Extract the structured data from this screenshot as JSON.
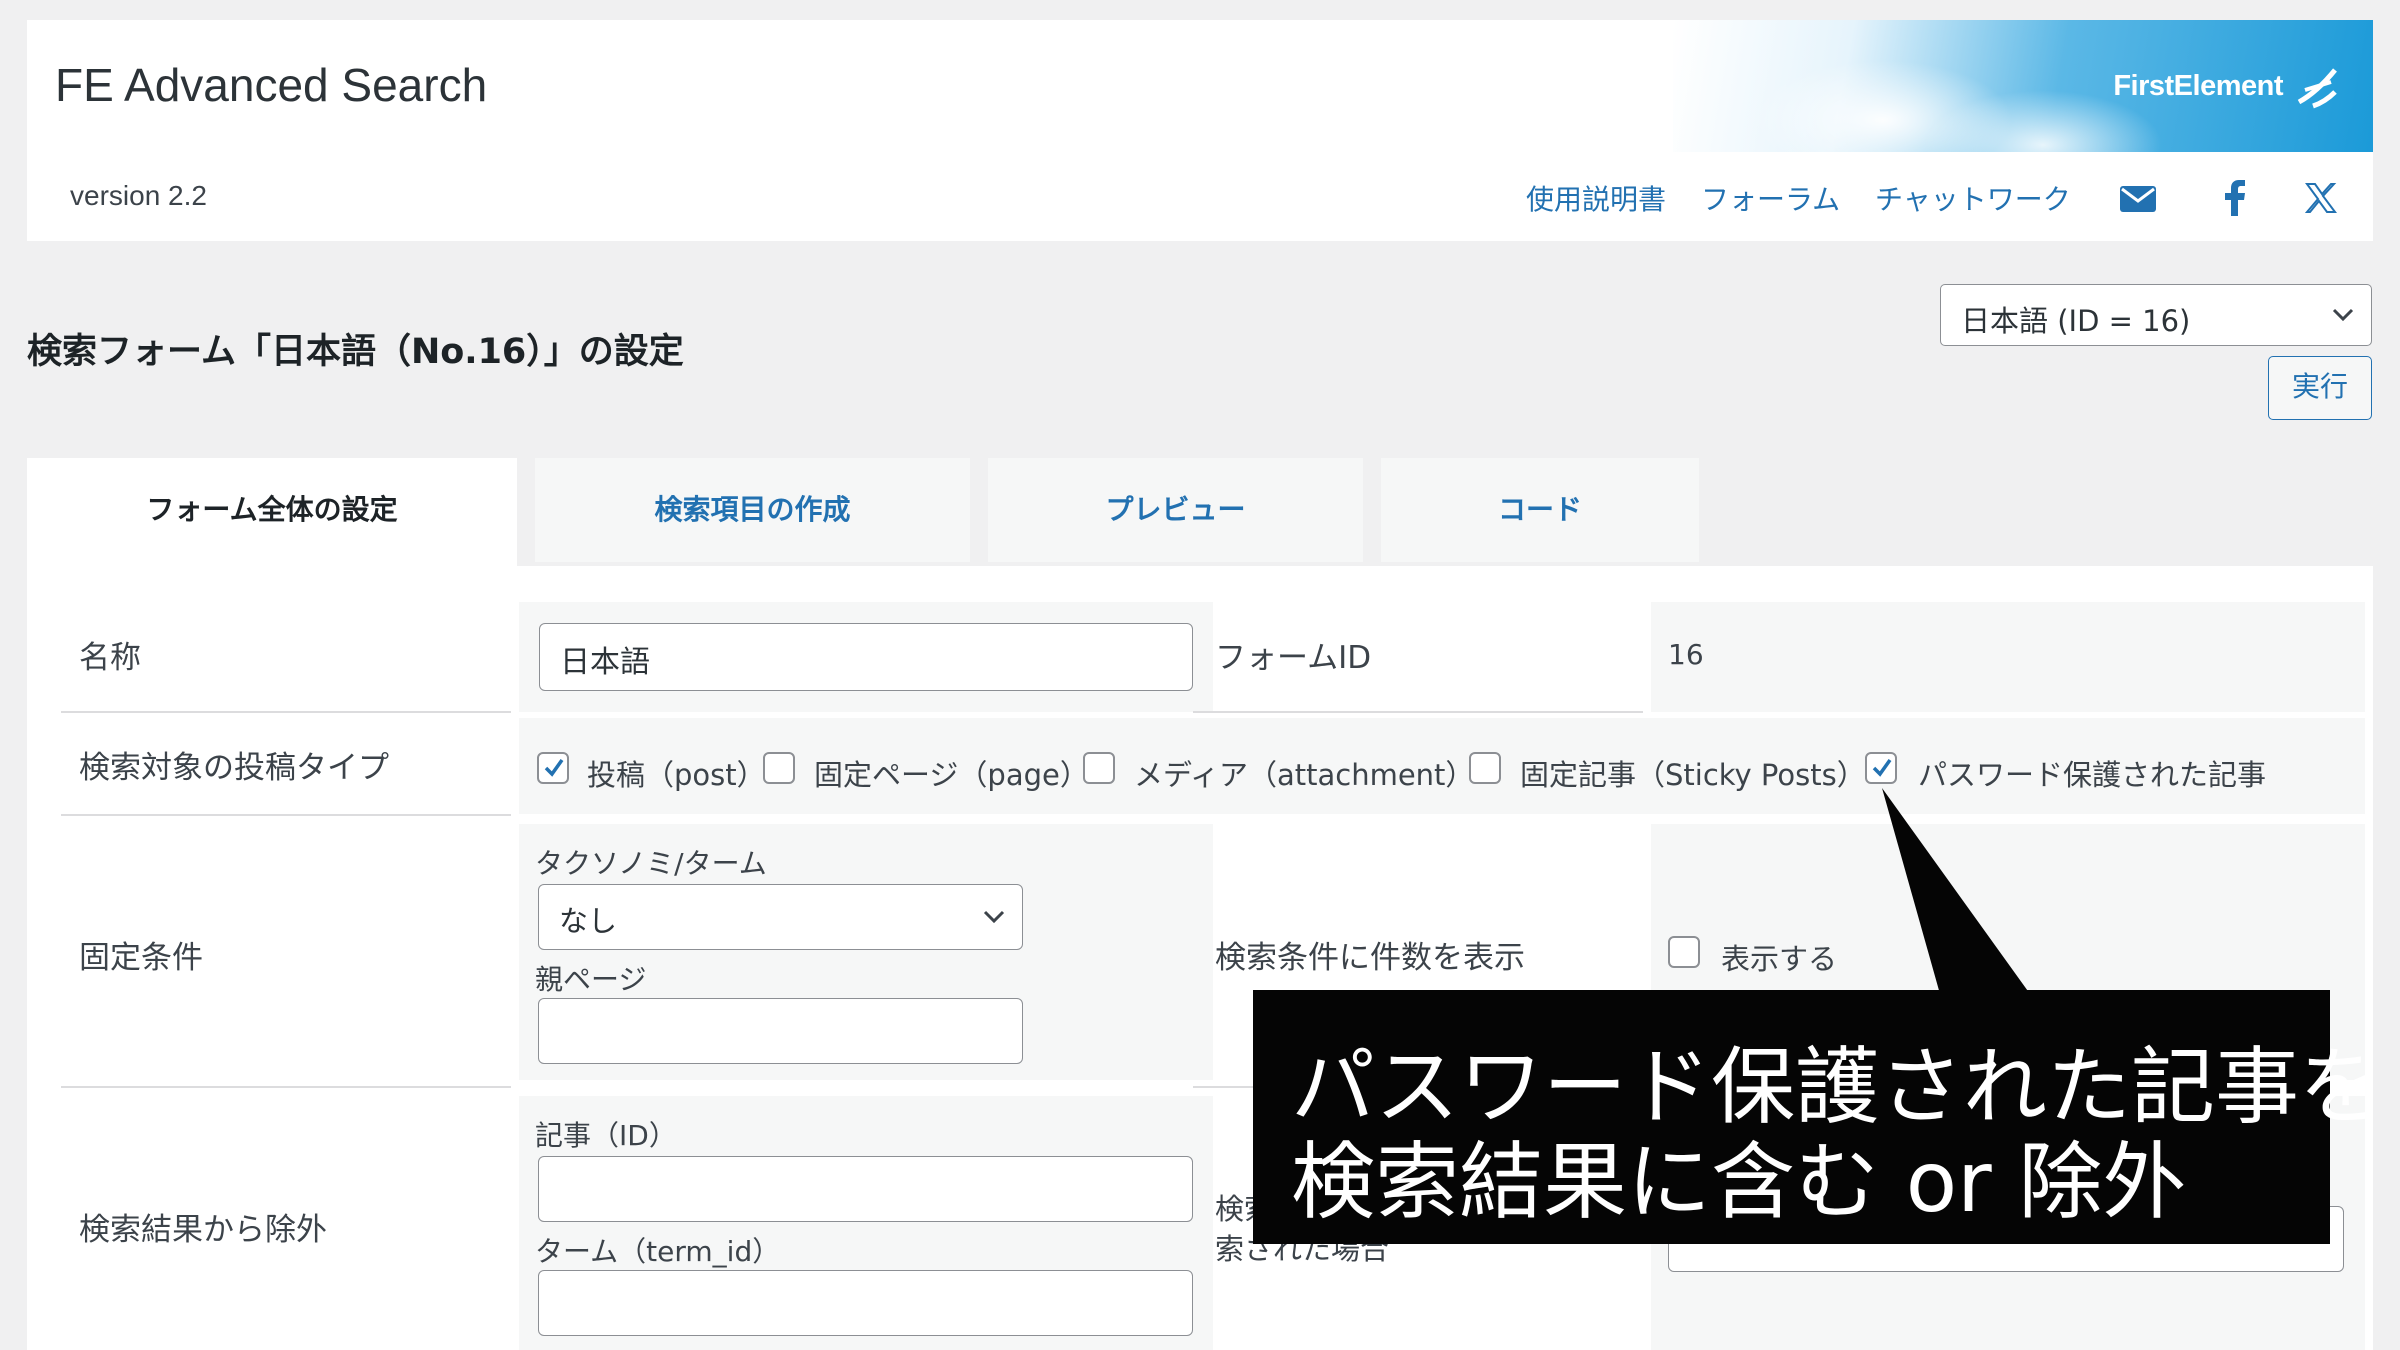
{
  "header": {
    "app_title": "FE Advanced Search",
    "version": "version 2.2",
    "brand": "FirstElement",
    "links": [
      "使用説明書",
      "フォーラム",
      "チャットワーク"
    ],
    "icons": [
      "mail-icon",
      "facebook-icon",
      "x-icon"
    ]
  },
  "section_title": "検索フォーム「日本語（No.16）」の設定",
  "form_select": {
    "value": "日本語 (ID = 16)"
  },
  "run_button": "実行",
  "tabs": [
    "フォーム全体の設定",
    "検索項目の作成",
    "プレビュー",
    "コード"
  ],
  "panel": {
    "name_label": "名称",
    "name_value": "日本語",
    "form_id_label": "フォームID",
    "form_id_value": "16",
    "post_types_label": "検索対象の投稿タイプ",
    "post_types": [
      {
        "label": "投稿（post）",
        "checked": true
      },
      {
        "label": "固定ページ（page）",
        "checked": false
      },
      {
        "label": "メディア（attachment）",
        "checked": false
      },
      {
        "label": "固定記事（Sticky Posts）",
        "checked": false
      },
      {
        "label": "パスワード保護された記事",
        "checked": true
      }
    ],
    "fixed_label": "固定条件",
    "taxonomy_label": "タクソノミ/ターム",
    "taxonomy_value": "なし",
    "parent_page_label": "親ページ",
    "count_label": "検索条件に件数を表示",
    "count_checkbox_label": "表示する",
    "exclude_label": "検索結果から除外",
    "exclude_post_label": "記事（ID）",
    "exclude_term_label": "ターム（term_id）",
    "partial_label_1": "検索",
    "partial_label_2": "索された場合"
  },
  "callout": {
    "line1": "パスワード保護された記事を",
    "line2": "検索結果に含む or 除外"
  },
  "colors": {
    "accent": "#2271b1",
    "bg": "#f0f0f1",
    "callout": "#050505"
  }
}
